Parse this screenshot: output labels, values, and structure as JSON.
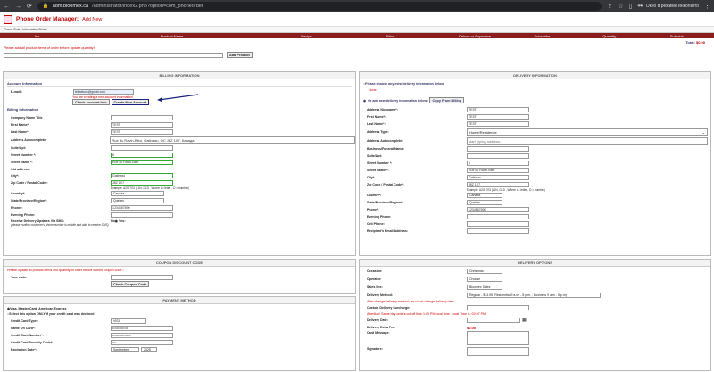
{
  "browser": {
    "url_host": "adm.bloomex.ca",
    "url_path": "/administrator/index2.php?option=com_phoneorder",
    "incognito": "Окно в режиме инкогнито"
  },
  "header": {
    "title": "Phone Order Manager:",
    "subtitle": "Add New"
  },
  "info_label": "Phone Order Information Detail",
  "columns": [
    "No",
    "Product Name",
    "Recipe",
    "Price",
    "Deluxe or Supersize",
    "Subscribe",
    "Quantity",
    "Subtotal"
  ],
  "total_label": "Total:",
  "total_value": "$0.00",
  "add_notice": "Please add all product items of order before update quantity!",
  "add_product": "Add Product",
  "billing": {
    "title": "BILLING INFORMATION",
    "account_info": "Account Information",
    "email_label": "E-mail*:",
    "email_value": "fekaekuis@gmail.com",
    "creating": "You are creating a new account information!",
    "check": "Check Account Info",
    "create": "Create New Account",
    "billing_info": "Billing Information",
    "company": "Company Name Title",
    "first": "First Name*:",
    "first_val": "TEST",
    "last": "Last Name*:",
    "last_val": "TEST",
    "autocomplete": "Address Autocomplete:",
    "autocomplete_val": "Rue du Ravin-Bleu, Gatineau, QC J8Z 1X7, Канада",
    "suite": "Suite/Apt:",
    "streetnum": "Street Number *:",
    "streetnum_val": "6",
    "streetname": "Street Name *:",
    "streetname_val": "Rue du Ravin-Bleu",
    "old": "Old address:",
    "city": "City*:",
    "city_val": "Gatineau",
    "zip": "Zip Code / Postal Code*:",
    "zip_val": "J8Z 1X7",
    "zip_example": "Example: A2G 7X3 (L1N, DLD , Where L= letter , D = number)",
    "country": "Country*:",
    "country_val": "Canada",
    "state": "State/Province/Region*:",
    "state_val": "Quebec",
    "phone": "Phone*:",
    "phone_val": "1234567890",
    "evening": "Evening Phone:",
    "sms": "Receive Delivery Updates Via SMS:",
    "sms_note": "(please confirm customer's phone number is mobile and able to receive SMS)",
    "no": "No",
    "yes": "Yes"
  },
  "coupon": {
    "title": "COUPON DISCOUNT CODE",
    "notice": "Please update all product items and quantity of order before submit coupon code !",
    "label": "Your code:",
    "btn": "Check Coupon Code"
  },
  "payment": {
    "title": "PAYMENT METHOD",
    "opt1": "Visa, Master Card, American Express",
    "opt2": "Select this option ONLY if your credit card was declined",
    "card_type": "Credit Card Type*:",
    "card_type_val": "VISA",
    "name": "Name On Card*:",
    "name_val": "••••••••••••••",
    "num": "Credit Card Number*:",
    "num_val": "•••••••••••••••••",
    "sec": "Credit Card Security Code*:",
    "sec_val": "•••",
    "exp": "Expiration Date*:",
    "exp_m": "September",
    "exp_y": "2025"
  },
  "delivery": {
    "title": "DELIVERY INFORMATION",
    "opt_exist": "Please choose any exist delivery information below:",
    "none": "None",
    "opt_new": "Or add new delivery information below:",
    "copy": "Copy From Billing",
    "nick": "Address Nickname*:",
    "nick_val": "TEST",
    "first": "First Name*:",
    "first_val": "TEST",
    "last": "Last Name*:",
    "last_val": "TEST",
    "type": "Address Type:",
    "type_val": "Home/Residence",
    "autocomplete": "Address Autocomplete:",
    "autocomplete_ph": "start typing address...",
    "business": "Business/Funeral Name:",
    "suite": "Suite/Apt:",
    "streetnum": "Street Number *:",
    "streetnum_val": "6",
    "streetname": "Street Name *:",
    "streetname_val": "Rue du Ravin-Bleu",
    "city": "City*:",
    "city_val": "Gatineau",
    "zip": "Zip Code / Postal Code*:",
    "zip_val": "J8Z 1X7",
    "zip_example": "Example: A2G 7X3 (L1N, DLD , Where L= letter , D = number)",
    "country": "Country*:",
    "country_val": "Canada",
    "state": "State/Province/Region*:",
    "state_val": "Quebec",
    "phone": "Phone*:",
    "phone_val": "1234567890",
    "evening": "Evening Phone:",
    "cell": "Cell Phone:",
    "email": "Recipient's Email Address:"
  },
  "delivery_options": {
    "title": "DELIVERY OPTIONS",
    "occasion": "Occasion:",
    "occasion_val": "Christmas",
    "operator": "Operator:",
    "operator_val": "Choose",
    "sales": "Sales line:",
    "sales_val": "Bloomex Sales",
    "method": "Delivery Method:",
    "method_val": "Regular - $14.95 (Residential 9 a.m. - 8 p.m. ; Business 9 a.m - 5 p.m)",
    "warn": "After change delivery method, you must change delivery date",
    "surcharge": "Custom Delivery Surcharge:",
    "attention": "Attention! Same day orders cut off time 1:00 PM local time. Local Time is: 02:07 PM",
    "date": "Delivery Date:",
    "fee": "Delivery Extra Fee:",
    "fee_val": "$0.00",
    "card": "Card Message:",
    "signature": "Signature:"
  }
}
